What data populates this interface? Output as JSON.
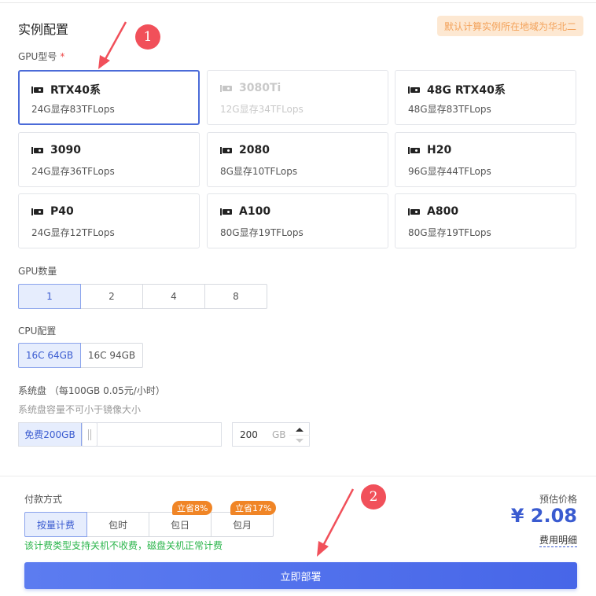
{
  "instance": {
    "section_title": "实例配置",
    "region_badge": "默认计算实例所在地域为华北二"
  },
  "gpu_model": {
    "label": "GPU型号",
    "required_mark": "*",
    "cards": [
      {
        "name": "RTX40系",
        "spec": "24G显存83TFLops",
        "state": "selected"
      },
      {
        "name": "3080Ti",
        "spec": "12G显存34TFLops",
        "state": "disabled"
      },
      {
        "name": "48G RTX40系",
        "spec": "48G显存83TFLops",
        "state": "normal"
      },
      {
        "name": "3090",
        "spec": "24G显存36TFLops",
        "state": "normal"
      },
      {
        "name": "2080",
        "spec": "8G显存10TFLops",
        "state": "normal"
      },
      {
        "name": "H20",
        "spec": "96G显存44TFLops",
        "state": "normal"
      },
      {
        "name": "P40",
        "spec": "24G显存12TFLops",
        "state": "normal"
      },
      {
        "name": "A100",
        "spec": "80G显存19TFLops",
        "state": "normal"
      },
      {
        "name": "A800",
        "spec": "80G显存19TFLops",
        "state": "normal"
      }
    ]
  },
  "gpu_count": {
    "label": "GPU数量",
    "options": [
      "1",
      "2",
      "4",
      "8"
    ],
    "selected": "1"
  },
  "cpu_config": {
    "label": "CPU配置",
    "options": [
      "16C 64GB",
      "16C 94GB"
    ],
    "selected": "16C 64GB"
  },
  "system_disk": {
    "label": "系统盘 （每100GB 0.05元/小时）",
    "hint": "系统盘容量不可小于镜像大小",
    "free_label": "免费200GB",
    "value": "200",
    "unit": "GB"
  },
  "payment": {
    "label": "付款方式",
    "options": [
      "按量计费",
      "包时",
      "包日",
      "包月"
    ],
    "selected": "按量计费",
    "badges": {
      "daily": "立省8%",
      "monthly": "立省17%"
    },
    "note": "该计费类型支持关机不收费，磁盘关机正常计费"
  },
  "price": {
    "label": "预估价格",
    "value": "¥ 2.08",
    "detail_link": "费用明细"
  },
  "deploy_button": "立即部署",
  "callouts": [
    "1",
    "2"
  ],
  "colors": {
    "accent": "#4766e8",
    "callout": "#f1505a",
    "badge_orange": "#f08526",
    "note_green": "#2bb54b",
    "region_badge_bg": "#fde8d2"
  }
}
